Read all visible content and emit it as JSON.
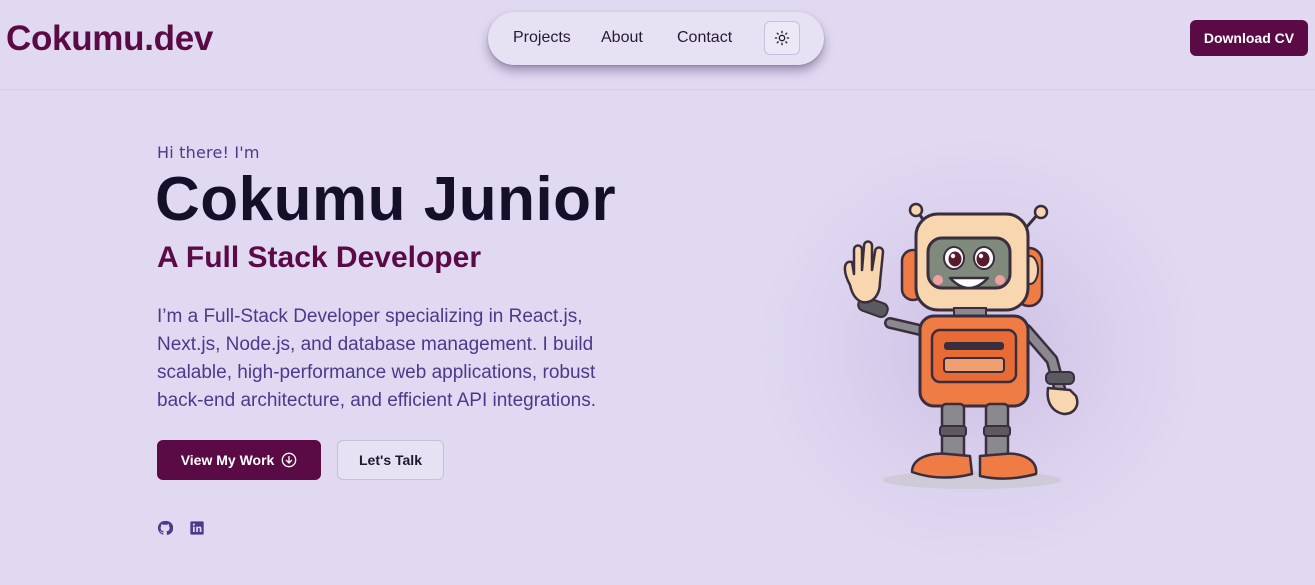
{
  "header": {
    "logo": "Cokumu.dev",
    "nav": [
      {
        "label": "Projects"
      },
      {
        "label": "About"
      },
      {
        "label": "Contact"
      }
    ],
    "theme_toggle_icon": "sun-icon",
    "cv_button": "Download CV"
  },
  "hero": {
    "greeting": "Hi there! I'm",
    "name": "Cokumu Junior",
    "role": "A Full Stack Developer",
    "bio": "I’m a Full-Stack Developer specializing in React.js, Next.js, Node.js, and database management. I build scalable, high-performance web applications, robust back-end architecture, and efficient API integrations.",
    "primary_button": "View My Work",
    "primary_button_icon": "arrow-down-circle-icon",
    "secondary_button": "Let's Talk",
    "socials": [
      {
        "icon": "github-icon"
      },
      {
        "icon": "linkedin-icon"
      }
    ],
    "illustration": "waving-robot"
  },
  "colors": {
    "background": "#e0d9f1",
    "brand": "#5a0a45",
    "accent_text": "#4a3a8c",
    "heading": "#15102a"
  }
}
